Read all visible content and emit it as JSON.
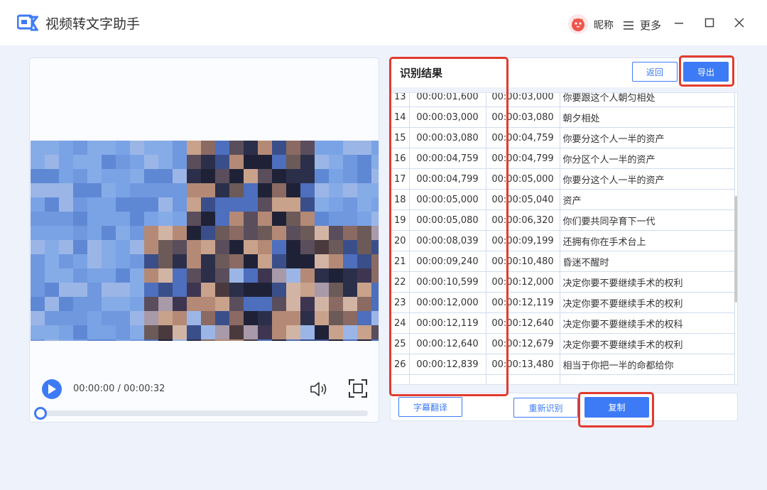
{
  "app": {
    "title": "视频转文字助手",
    "nickname": "昵称",
    "more_label": "更多"
  },
  "player": {
    "time_display": "00:00:00 / 00:00:32",
    "progress": 0
  },
  "result": {
    "title": "识别结果",
    "back_label": "返回",
    "export_label": "导出",
    "rows": [
      {
        "idx": "13",
        "start": "00:00:01,600",
        "end": "00:00:03,000",
        "text": "你要跟这个人朝匀相处"
      },
      {
        "idx": "14",
        "start": "00:00:03,000",
        "end": "00:00:03,080",
        "text": "朝夕相处"
      },
      {
        "idx": "15",
        "start": "00:00:03,080",
        "end": "00:00:04,759",
        "text": "你要分这个人一半的资产"
      },
      {
        "idx": "16",
        "start": "00:00:04,759",
        "end": "00:00:04,799",
        "text": "你分区个人一半的资产"
      },
      {
        "idx": "17",
        "start": "00:00:04,799",
        "end": "00:00:05,000",
        "text": "你要分这个人一半的资产"
      },
      {
        "idx": "18",
        "start": "00:00:05,000",
        "end": "00:00:05,040",
        "text": "资产"
      },
      {
        "idx": "19",
        "start": "00:00:05,080",
        "end": "00:00:06,320",
        "text": "你们要共同孕育下一代"
      },
      {
        "idx": "20",
        "start": "00:00:08,039",
        "end": "00:00:09,199",
        "text": "还拥有你在手术台上"
      },
      {
        "idx": "21",
        "start": "00:00:09,240",
        "end": "00:00:10,480",
        "text": "昏迷不醒时"
      },
      {
        "idx": "22",
        "start": "00:00:10,599",
        "end": "00:00:12,000",
        "text": "决定你要不要继续手术的权利"
      },
      {
        "idx": "23",
        "start": "00:00:12,000",
        "end": "00:00:12,119",
        "text": "决定你要不要继续手术的权利"
      },
      {
        "idx": "24",
        "start": "00:00:12,119",
        "end": "00:00:12,640",
        "text": "决定你要不要继续手术的权科"
      },
      {
        "idx": "25",
        "start": "00:00:12,640",
        "end": "00:00:12,679",
        "text": "决定你要不要继续手术的权利"
      },
      {
        "idx": "26",
        "start": "00:00:12,839",
        "end": "00:00:13,480",
        "text": "相当于你把一半的命都给你"
      }
    ],
    "subtitle_translate_label": "字幕翻译",
    "re_recognize_label": "重新识别",
    "copy_label": "复制"
  },
  "colors": {
    "accent": "#3d7bf6",
    "highlight": "#e23a2e",
    "background": "#eef2fb"
  },
  "icons": [
    "app-logo-icon",
    "avatar-icon",
    "menu-icon",
    "minimize-icon",
    "maximize-icon",
    "close-icon",
    "play-icon",
    "volume-icon",
    "fullscreen-icon"
  ]
}
